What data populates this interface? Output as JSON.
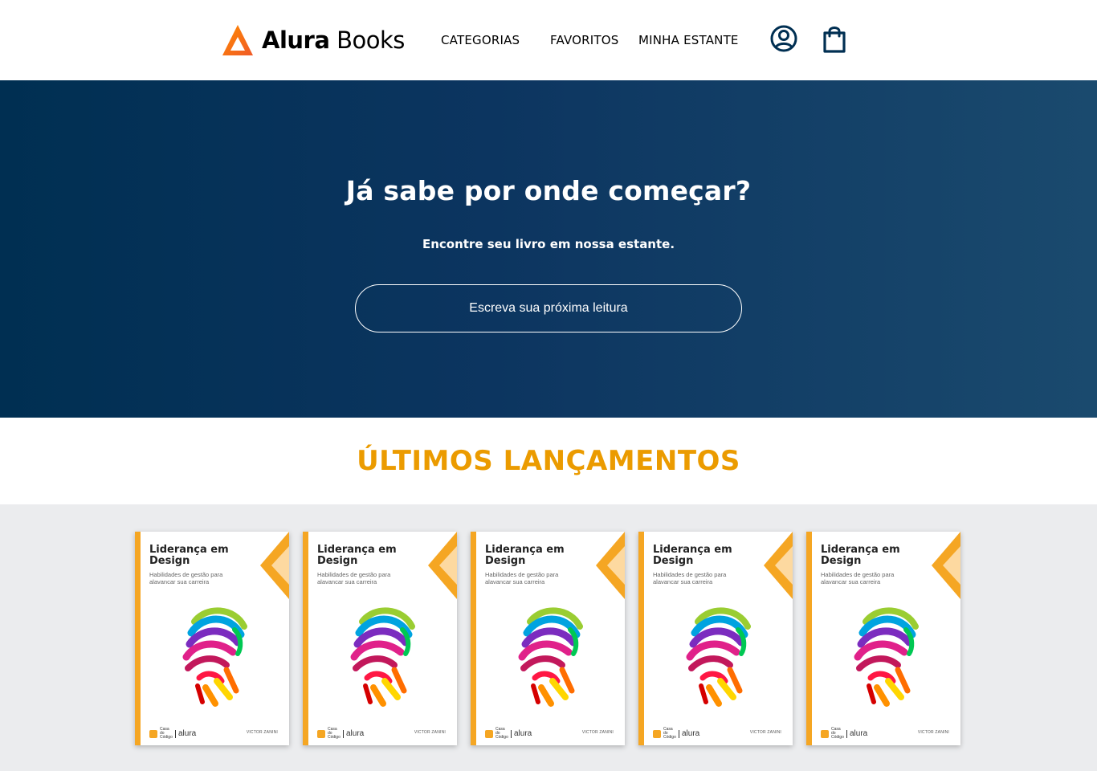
{
  "header": {
    "logo_bold": "Alura",
    "logo_light": "Books",
    "nav": [
      {
        "label": "CATEGORIAS"
      },
      {
        "label": "FAVORITOS"
      },
      {
        "label": "MINHA ESTANTE"
      }
    ],
    "icons": [
      "user-icon",
      "shopping-bag-icon"
    ],
    "brand_color": "#f26522"
  },
  "hero": {
    "title": "Já sabe por onde começar?",
    "subtitle": "Encontre seu livro em nossa estante.",
    "search_placeholder": "Escreva sua próxima leitura",
    "gradient_start": "#002f52",
    "gradient_end": "#1a4a6e"
  },
  "launches": {
    "title": "ÚLTIMOS LANÇAMENTOS",
    "title_color": "#eb9b00",
    "books": [
      {
        "title": "Liderança em Design",
        "subtitle": "Habilidades de gestão para alavancar sua carreira",
        "publisher": "Casa do Código",
        "brand": "alura",
        "author": "VICTOR ZANINI"
      },
      {
        "title": "Liderança em Design",
        "subtitle": "Habilidades de gestão para alavancar sua carreira",
        "publisher": "Casa do Código",
        "brand": "alura",
        "author": "VICTOR ZANINI"
      },
      {
        "title": "Liderança em Design",
        "subtitle": "Habilidades de gestão para alavancar sua carreira",
        "publisher": "Casa do Código",
        "brand": "alura",
        "author": "VICTOR ZANINI"
      },
      {
        "title": "Liderança em Design",
        "subtitle": "Habilidades de gestão para alavancar sua carreira",
        "publisher": "Casa do Código",
        "brand": "alura",
        "author": "VICTOR ZANINI"
      },
      {
        "title": "Liderança em Design",
        "subtitle": "Habilidades de gestão para alavancar sua carreira",
        "publisher": "Casa do Código",
        "brand": "alura",
        "author": "VICTOR ZANINI"
      }
    ]
  }
}
